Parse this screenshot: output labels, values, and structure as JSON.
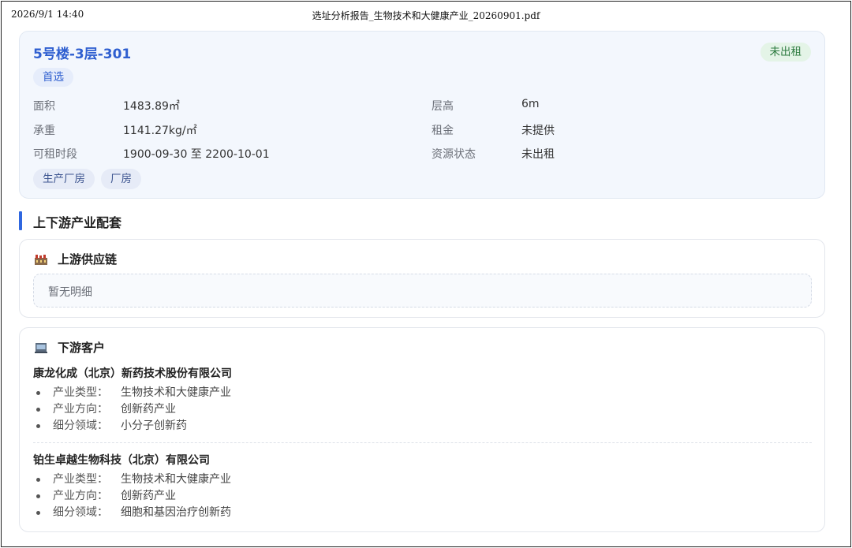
{
  "print_header": {
    "datetime": "2026/9/1 14:40",
    "doc_title": "选址分析报告_生物技术和大健康产业_20260901.pdf"
  },
  "unit": {
    "title": "5号楼-3层-301",
    "status": "未出租",
    "preference_tag": "首选",
    "fields": {
      "area_label": "面积",
      "area_value": "1483.89㎡",
      "height_label": "层高",
      "height_value": "6m",
      "load_label": "承重",
      "load_value": "1141.27kg/㎡",
      "rent_label": "租金",
      "rent_value": "未提供",
      "period_label": "可租时段",
      "period_value": "1900-09-30 至 2200-10-01",
      "resource_label": "资源状态",
      "resource_value": "未出租"
    },
    "tags": [
      "生产厂房",
      "厂房"
    ]
  },
  "section": {
    "title": "上下游产业配套"
  },
  "upstream": {
    "icon": "factory-icon",
    "title": "上游供应链",
    "empty_text": "暂无明细"
  },
  "downstream": {
    "icon": "building-icon",
    "title": "下游客户",
    "companies": [
      {
        "name": "康龙化成（北京）新药技术股份有限公司",
        "details": [
          {
            "label": "产业类型：",
            "value": "生物技术和大健康产业"
          },
          {
            "label": "产业方向：",
            "value": "创新药产业"
          },
          {
            "label": "细分领域：",
            "value": "小分子创新药"
          }
        ]
      },
      {
        "name": "铂生卓越生物科技（北京）有限公司",
        "details": [
          {
            "label": "产业类型：",
            "value": "生物技术和大健康产业"
          },
          {
            "label": "产业方向：",
            "value": "创新药产业"
          },
          {
            "label": "细分领域：",
            "value": "细胞和基因治疗创新药"
          }
        ]
      }
    ]
  },
  "colors": {
    "accent": "#2f5fd0",
    "status_green": "#2c7a3f",
    "section_bar": "#2f67e0"
  }
}
